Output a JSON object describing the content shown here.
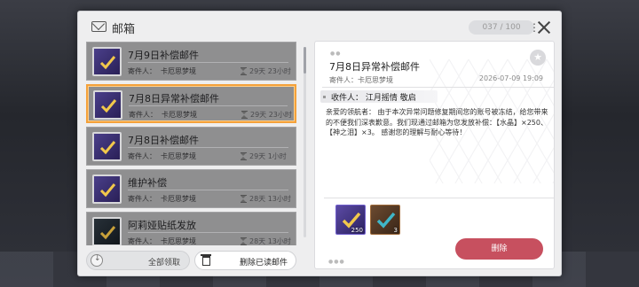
{
  "window": {
    "title": "邮箱",
    "mail_count": "037 / 100"
  },
  "mails": [
    {
      "title": "7月9日补偿邮件",
      "sender_label": "寄件人：",
      "sender": "卡厄思梦境",
      "time_left": "29天 23小时",
      "selected": false,
      "thumb": "purple"
    },
    {
      "title": "7月8日异常补偿邮件",
      "sender_label": "寄件人：",
      "sender": "卡厄思梦境",
      "time_left": "29天 23小时",
      "selected": true,
      "thumb": "purple"
    },
    {
      "title": "7月8日补偿邮件",
      "sender_label": "寄件人：",
      "sender": "卡厄思梦境",
      "time_left": "29天 1小时",
      "selected": false,
      "thumb": "purple"
    },
    {
      "title": "维护补偿",
      "sender_label": "寄件人：",
      "sender": "卡厄思梦境",
      "time_left": "28天 13小时",
      "selected": false,
      "thumb": "purple"
    },
    {
      "title": "阿莉娅贴纸发放",
      "sender_label": "寄件人：",
      "sender": "卡厄思梦境",
      "time_left": "28天 13小时",
      "selected": false,
      "thumb": "dark"
    }
  ],
  "buttons": {
    "claim_all": "全部领取",
    "delete_read": "删除已读邮件",
    "delete": "删除"
  },
  "detail": {
    "title": "7月8日异常补偿邮件",
    "sender_label": "寄件人：",
    "sender": "卡厄思梦境",
    "date": "2026-07-09 19:09",
    "recipient": "收件人：  江月摇情 敬启",
    "body": "亲爱的领航者： 由于本次异常问题修复期间您的账号被冻结，给您带来的不便我们深表歉意。我们现通过邮箱为您发放补偿：【水晶】×250、【神之泪】×3。 感谢您的理解与耐心等待！",
    "attachments": [
      {
        "name": "crystal",
        "qty": "250"
      },
      {
        "name": "tears-of-god",
        "qty": "3"
      }
    ]
  },
  "icons": {
    "mail": "mail-icon",
    "more": "more-icon",
    "close": "close-icon",
    "hourglass": "hourglass-icon",
    "claim": "download-icon",
    "trash": "trash-icon",
    "star": "star-icon"
  },
  "colors": {
    "accent_selected": "#f4a13a",
    "delete_button": "#c7505f"
  }
}
